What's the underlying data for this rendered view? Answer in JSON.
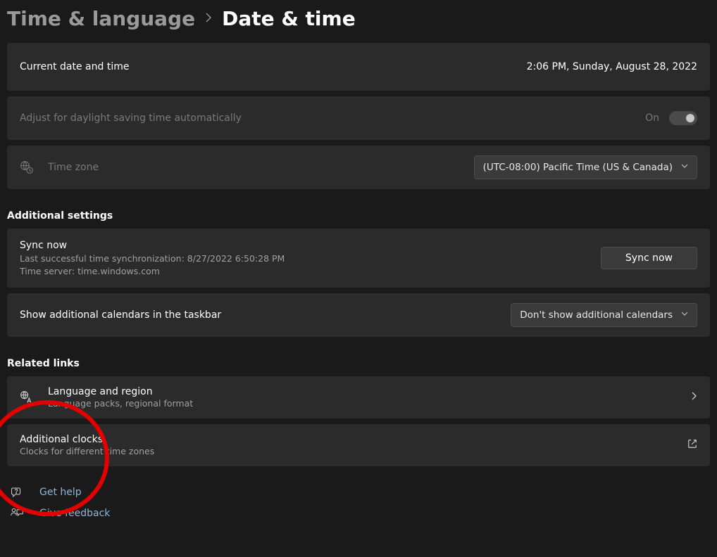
{
  "breadcrumb": {
    "parent": "Time & language",
    "current": "Date & time"
  },
  "currentDateTime": {
    "label": "Current date and time",
    "value": "2:06 PM, Sunday, August 28, 2022"
  },
  "dst": {
    "label": "Adjust for daylight saving time automatically",
    "status": "On"
  },
  "timezone": {
    "label": "Time zone",
    "selected": "(UTC-08:00) Pacific Time (US & Canada)"
  },
  "sections": {
    "additional": "Additional settings",
    "related": "Related links"
  },
  "sync": {
    "title": "Sync now",
    "lastSync": "Last successful time synchronization: 8/27/2022 6:50:28 PM",
    "server": "Time server: time.windows.com",
    "button": "Sync now"
  },
  "calendars": {
    "label": "Show additional calendars in the taskbar",
    "selected": "Don't show additional calendars"
  },
  "related": {
    "language": {
      "title": "Language and region",
      "subtitle": "Language packs, regional format"
    },
    "clocks": {
      "title": "Additional clocks",
      "subtitle": "Clocks for different time zones"
    }
  },
  "footer": {
    "help": "Get help",
    "feedback": "Give feedback"
  }
}
